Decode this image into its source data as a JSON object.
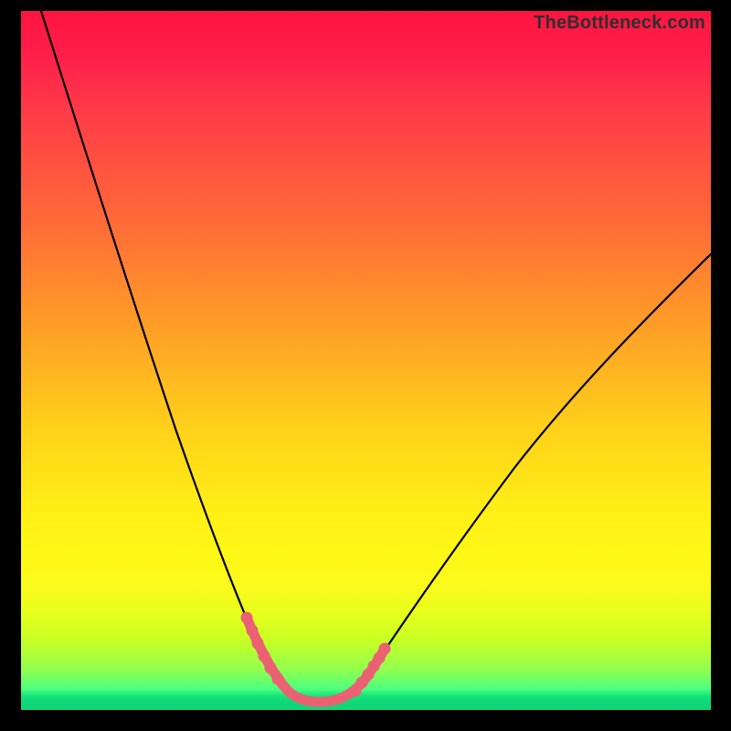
{
  "watermark": "TheBottleneck.com",
  "colors": {
    "frame": "#000000",
    "curve": "#000000",
    "highlight": "#eb6173",
    "gradient_top": "#ff1440",
    "gradient_mid": "#fff016",
    "gradient_bottom": "#10d879"
  },
  "chart_data": {
    "type": "line",
    "title": "",
    "xlabel": "",
    "ylabel": "",
    "xlim": [
      0,
      100
    ],
    "ylim": [
      0,
      100
    ],
    "note": "Bottleneck percentage curve. Y is bottleneck percentage (0 at bottom, ~100 at top). X is the swept parameter. Values estimated from pixel positions; no axis ticks shown.",
    "series": [
      {
        "name": "bottleneck-curve",
        "x": [
          3,
          6,
          9,
          12,
          15,
          18,
          21,
          24,
          27,
          30,
          32,
          34,
          36,
          38,
          41,
          44,
          48,
          52,
          56,
          60,
          64,
          68,
          72,
          76,
          80,
          84,
          88,
          92,
          96,
          100
        ],
        "y": [
          100,
          92,
          84,
          76,
          68,
          60,
          52,
          44,
          36,
          28,
          22,
          16,
          11,
          7,
          3,
          1.5,
          1.2,
          2.5,
          5,
          9,
          13,
          17,
          21,
          25,
          29,
          32,
          35.5,
          38.5,
          41.5,
          44.5
        ]
      },
      {
        "name": "highlight-segment",
        "x": [
          33.5,
          34.5,
          35.5,
          36.5,
          37.5,
          38.5,
          40,
          41.5,
          43,
          44.5,
          46,
          47.5,
          48.5,
          49.5,
          50.5,
          51.5,
          52.5
        ],
        "y": [
          18,
          14.5,
          11.5,
          9,
          7,
          5,
          3.2,
          2.2,
          1.7,
          1.5,
          1.5,
          1.7,
          2.1,
          2.7,
          3.5,
          4.5,
          5.5
        ]
      }
    ],
    "highlight_markers_x": [
      33.5,
      34.5,
      35.5,
      36.5,
      37.5,
      38.5,
      47.5,
      48.5,
      49.5,
      50.5,
      51.5,
      52.5
    ]
  }
}
